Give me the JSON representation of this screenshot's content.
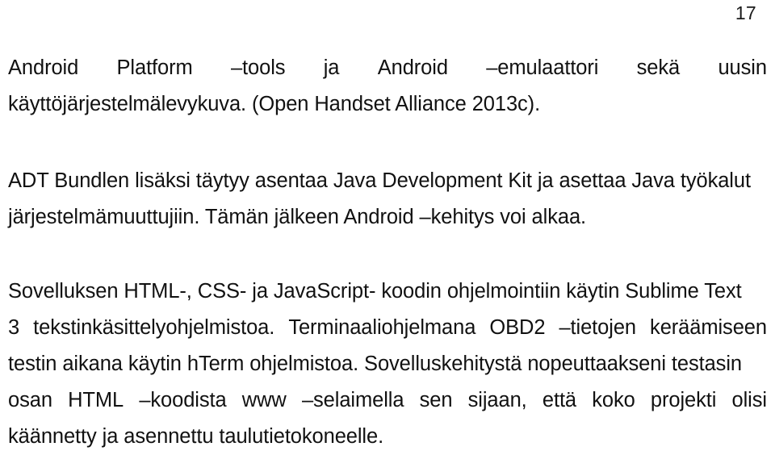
{
  "document": {
    "page_number": "17",
    "language": "fi",
    "paragraphs": [
      {
        "id": "paragraph-1",
        "text": "Android Platform –tools ja Android –emulaattori sekä uusin käyttöjärjestelmälevykuva. (Open Handset Alliance 2013c).",
        "lines": [
          {
            "justified": true,
            "words": [
              "Android",
              "Platform",
              "–tools",
              "ja",
              "Android",
              "–emulaattori",
              "sekä",
              "uusin"
            ]
          },
          {
            "justified": false,
            "words": [
              "käyttöjärjestelmälevykuva. (Open Handset Alliance 2013c)."
            ]
          }
        ]
      },
      {
        "id": "paragraph-2",
        "text": "ADT Bundlen lisäksi täytyy asentaa Java Development Kit ja asettaa Java työkalut järjestelmämuuttujiin. Tämän jälkeen Android –kehitys voi alkaa.",
        "lines": [
          {
            "justified": false,
            "words": [
              "ADT Bundlen lisäksi täytyy asentaa Java Development Kit ja asettaa Java työkalut"
            ]
          },
          {
            "justified": false,
            "words": [
              "järjestelmämuuttujiin. Tämän jälkeen Android –kehitys voi alkaa."
            ]
          }
        ]
      },
      {
        "id": "paragraph-3",
        "text": "Sovelluksen HTML-, CSS- ja JavaScript- koodin ohjelmointiin käytin Sublime Text 3 tekstinkäsittelyohjelmistoa. Terminaaliohjelmana OBD2 –tietojen keräämiseen testin aikana käytin hTerm ohjelmistoa. Sovelluskehitystä nopeuttaakseni testasin osan HTML –koodista www –selaimella sen sijaan, että koko projekti olisi käännetty ja asennettu taulutietokoneelle.",
        "lines": [
          {
            "justified": false,
            "words": [
              "Sovelluksen HTML-, CSS- ja JavaScript- koodin ohjelmointiin käytin Sublime Text"
            ]
          },
          {
            "justified": true,
            "words": [
              "3",
              "tekstinkäsittelyohjelmistoa.",
              "Terminaaliohjelmana",
              "OBD2",
              "–tietojen",
              "keräämiseen"
            ]
          },
          {
            "justified": false,
            "words": [
              "testin aikana käytin hTerm ohjelmistoa. Sovelluskehitystä nopeuttaakseni testasin"
            ]
          },
          {
            "justified": true,
            "words": [
              "osan",
              "HTML",
              "–koodista",
              "www",
              "–selaimella",
              "sen",
              "sijaan,",
              "että",
              "koko",
              "projekti",
              "olisi"
            ]
          },
          {
            "justified": false,
            "words": [
              "käännetty ja asennettu taulutietokoneelle."
            ]
          }
        ]
      }
    ]
  }
}
